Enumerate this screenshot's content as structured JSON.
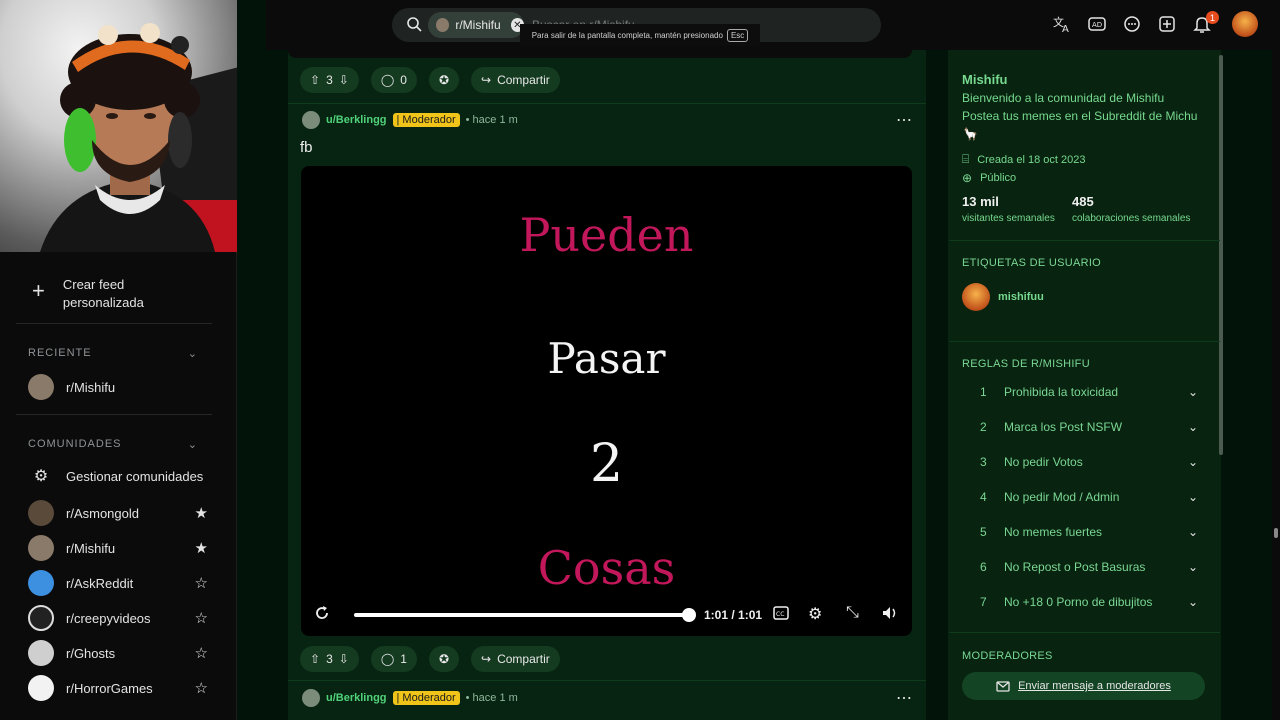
{
  "header": {
    "search_chip_label": "r/Mishifu",
    "search_placeholder": "Buscar en r/Mishifu",
    "fullscreen_tip": "Para salir de la pantalla completa, mantén presionado",
    "fullscreen_key": "Esc",
    "notification_count": "1"
  },
  "sidebar": {
    "create_feed_line1": "Crear feed",
    "create_feed_line2": "personalizada",
    "recent_header": "RECIENTE",
    "recent_items": [
      {
        "label": "r/Mishifu"
      }
    ],
    "communities_header": "COMUNIDADES",
    "manage_label": "Gestionar comunidades",
    "communities": [
      {
        "label": "r/Asmongold",
        "favorite": true
      },
      {
        "label": "r/Mishifu",
        "favorite": true
      },
      {
        "label": "r/AskReddit",
        "favorite": false
      },
      {
        "label": "r/creepyvideos",
        "favorite": false
      },
      {
        "label": "r/Ghosts",
        "favorite": false
      },
      {
        "label": "r/HorrorGames",
        "favorite": false
      }
    ]
  },
  "feed": {
    "top_actions": {
      "votes": "3",
      "comments": "0",
      "share": "Compartir"
    },
    "post": {
      "user": "u/Berklingg",
      "flair": "| Moderador",
      "time": "hace 1 m",
      "title": "fb",
      "video_lines": [
        "Pueden",
        "Pasar",
        "2",
        "Cosas"
      ],
      "video_time": "1:01 / 1:01",
      "actions": {
        "votes": "3",
        "comments": "1",
        "share": "Compartir"
      }
    },
    "next_post": {
      "user": "u/Berklingg",
      "flair": "| Moderador",
      "time": "hace 1 m"
    }
  },
  "community": {
    "name": "Mishifu",
    "welcome": "Bienvenido a la comunidad de Mishifu",
    "description": "Postea tus memes en el Subreddit de Michu",
    "created": "Creada el 18 oct 2023",
    "visibility": "Público",
    "weekly_visitors_value": "13 mil",
    "weekly_visitors_label": "visitantes semanales",
    "weekly_contributions_value": "485",
    "weekly_contributions_label": "colaboraciones semanales",
    "user_flair_header": "ETIQUETAS DE USUARIO",
    "user_flair_name": "mishifuu",
    "rules_header": "REGLAS DE R/MISHIFU",
    "rules": [
      {
        "num": "1",
        "text": "Prohibida la toxicidad"
      },
      {
        "num": "2",
        "text": "Marca los Post NSFW"
      },
      {
        "num": "3",
        "text": "No pedir Votos"
      },
      {
        "num": "4",
        "text": "No pedir Mod / Admin"
      },
      {
        "num": "5",
        "text": "No memes fuertes"
      },
      {
        "num": "6",
        "text": "No Repost o Post Basuras"
      },
      {
        "num": "7",
        "text": "No +18 0 Porno de dibujitos"
      }
    ],
    "moderators_header": "MODERADORES",
    "message_mods": "Enviar mensaje a moderadores"
  },
  "colors": {
    "accent_green": "#51d27a",
    "flair_yellow": "#f0c419",
    "video_red": "#c2185b",
    "notification_red": "#e74c1e"
  }
}
